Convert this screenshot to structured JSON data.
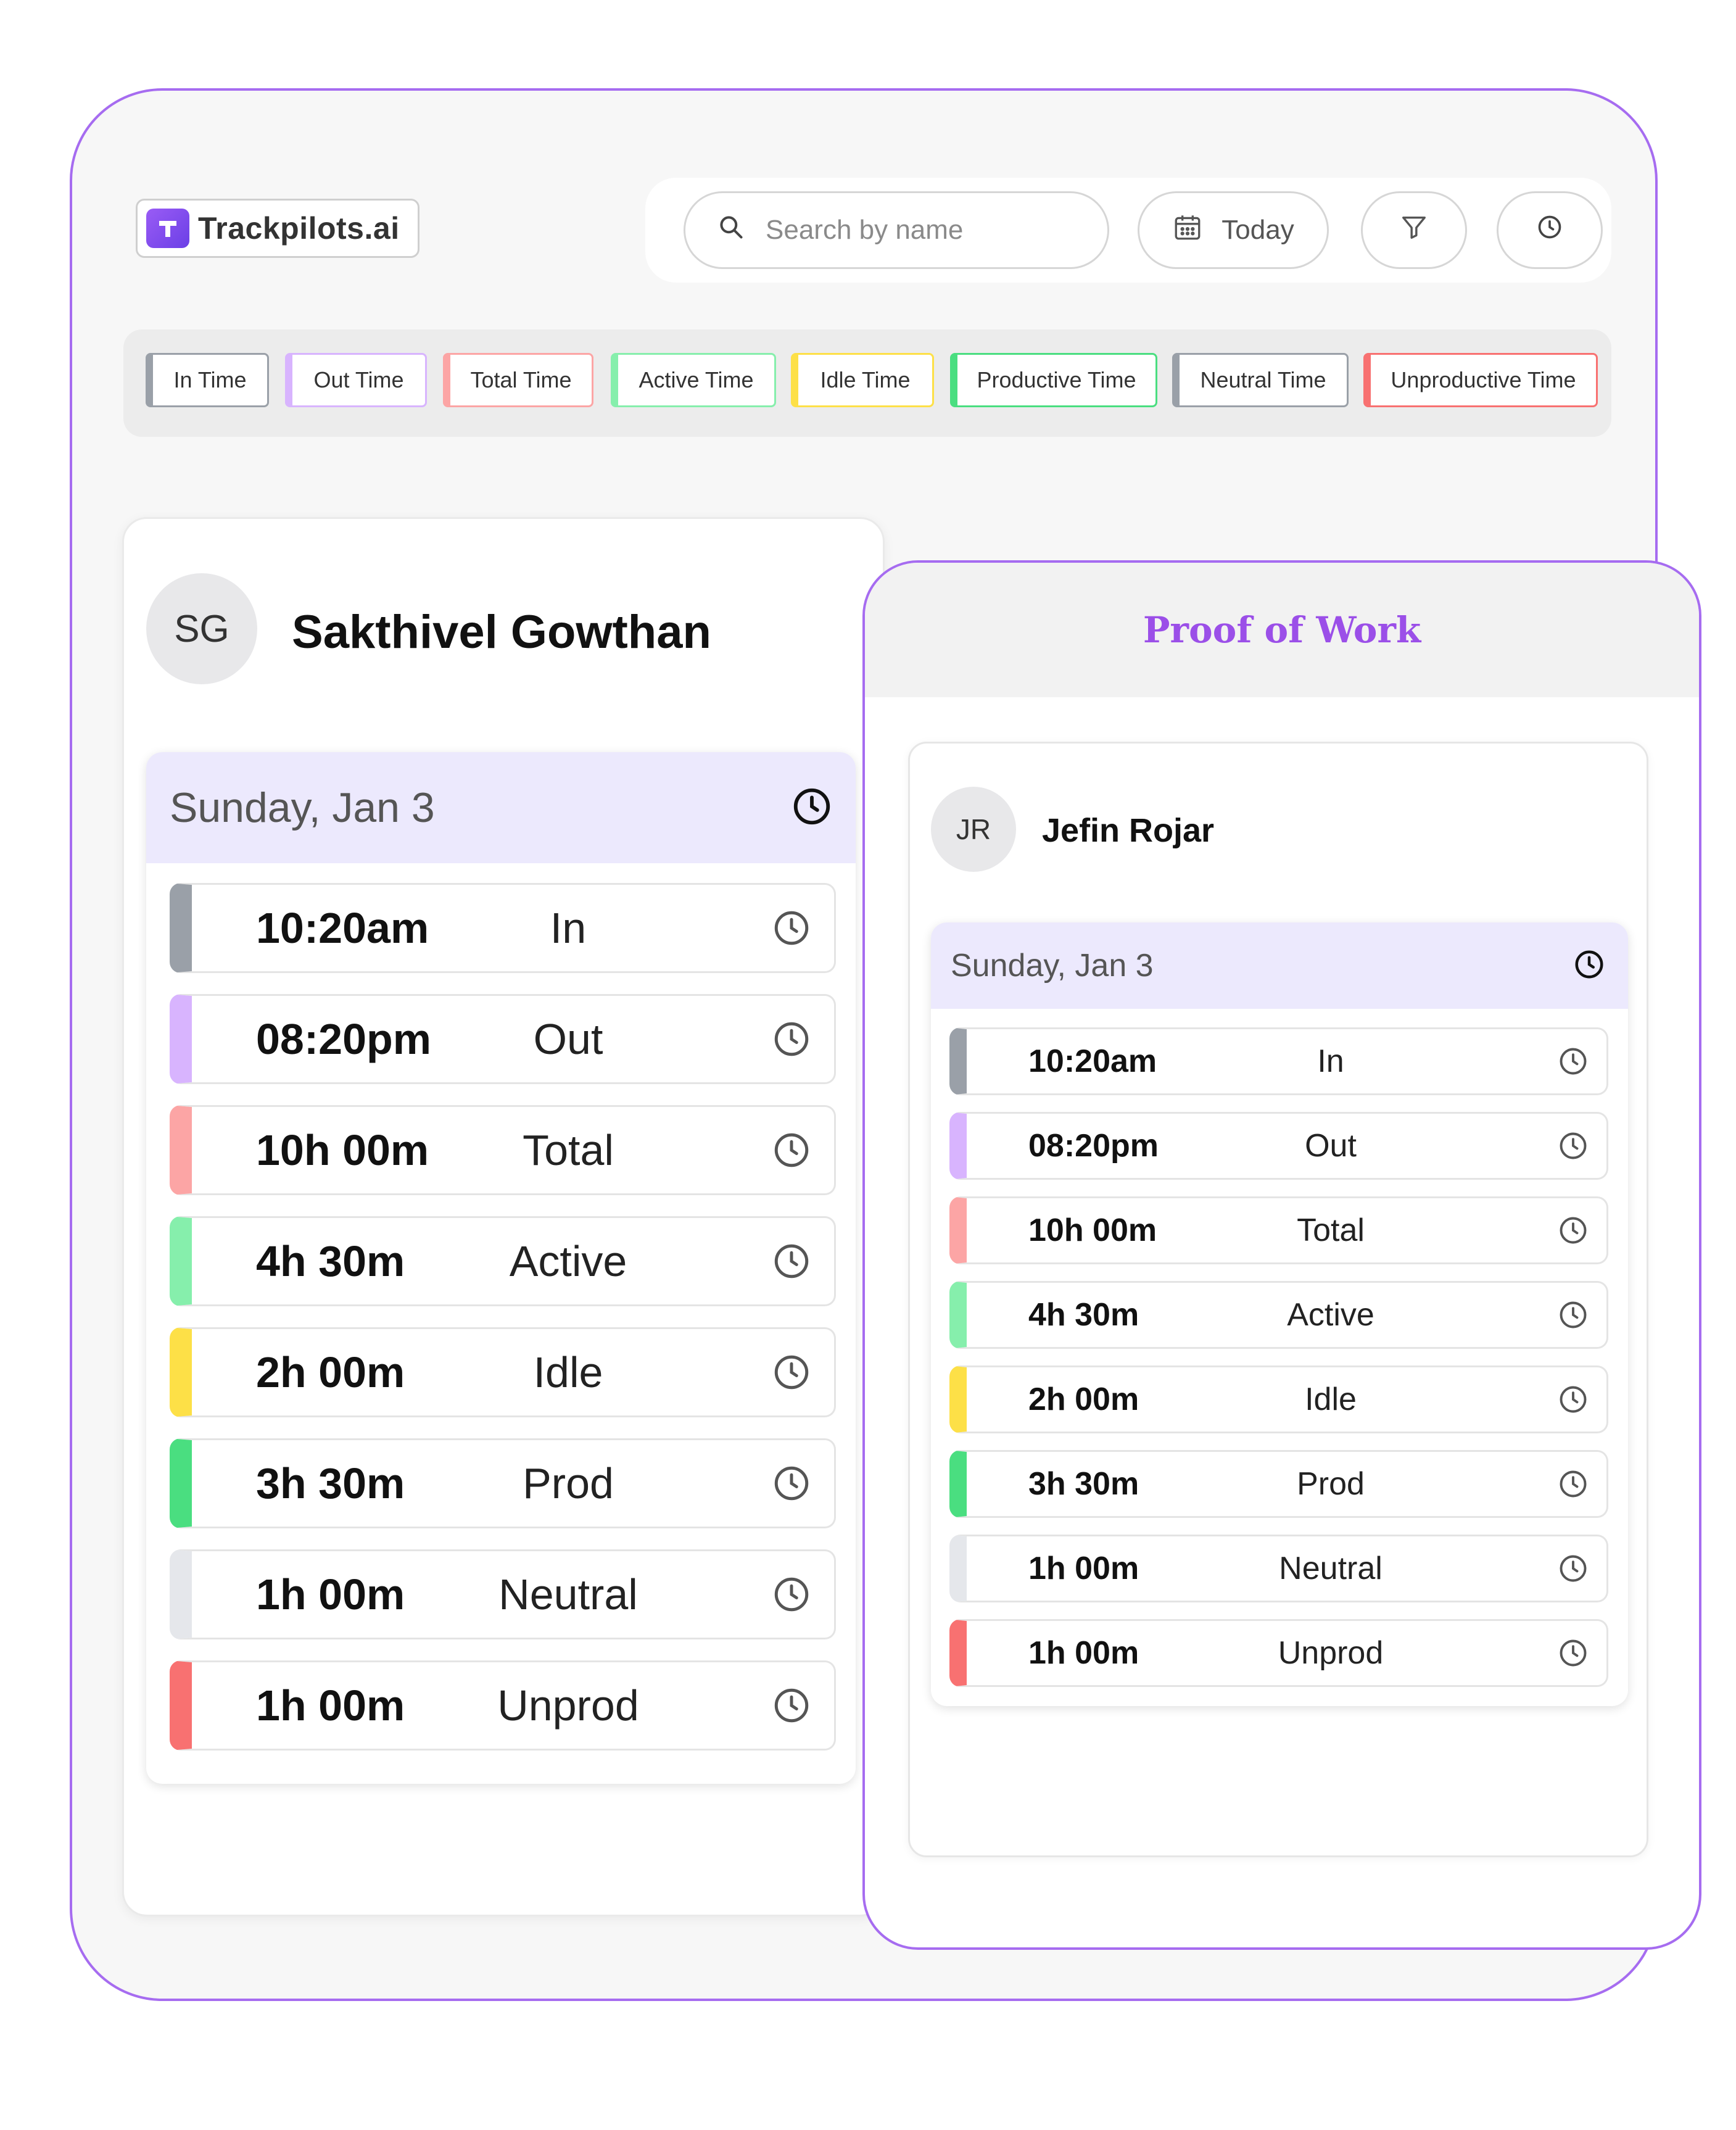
{
  "brand": {
    "name": "Trackpilots.ai",
    "logo_icon": "trackpilots-logo-icon",
    "accent": "#a66cf0"
  },
  "toolbar": {
    "search_placeholder": "Search by name",
    "search_icon": "search-icon",
    "date_label": "Today",
    "date_icon": "calendar-icon",
    "filter_icon": "filter-icon",
    "history_icon": "clock-icon"
  },
  "legend": [
    {
      "label": "In Time",
      "color": "#9aa0a8"
    },
    {
      "label": "Out Time",
      "color": "#d8b4fe"
    },
    {
      "label": "Total Time",
      "color": "#fca5a5"
    },
    {
      "label": "Active Time",
      "color": "#86efac"
    },
    {
      "label": "Idle Time",
      "color": "#fde047"
    },
    {
      "label": "Productive Time",
      "color": "#4ade80"
    },
    {
      "label": "Neutral Time",
      "color": "#9aa0a8"
    },
    {
      "label": "Unproductive Time",
      "color": "#f87171"
    }
  ],
  "left_card": {
    "initials": "SG",
    "name": "Sakthivel Gowthan",
    "day": "Sunday, Jan 3",
    "rows": [
      {
        "value": "10:20am",
        "label": "In",
        "color": "#9aa0a8"
      },
      {
        "value": "08:20pm",
        "label": "Out",
        "color": "#d8b4fe"
      },
      {
        "value": "10h 00m",
        "label": "Total",
        "color": "#fca5a5"
      },
      {
        "value": "4h 30m",
        "label": "Active",
        "color": "#86efac"
      },
      {
        "value": "2h 00m",
        "label": "Idle",
        "color": "#fde047"
      },
      {
        "value": "3h 30m",
        "label": "Prod",
        "color": "#4ade80"
      },
      {
        "value": "1h 00m",
        "label": "Neutral",
        "color": "#e5e7eb"
      },
      {
        "value": "1h 00m",
        "label": "Unprod",
        "color": "#f87171"
      }
    ]
  },
  "right_card": {
    "title": "Proof of Work",
    "initials": "JR",
    "name": "Jefin Rojar",
    "day": "Sunday, Jan 3",
    "rows": [
      {
        "value": "10:20am",
        "label": "In",
        "color": "#9aa0a8"
      },
      {
        "value": "08:20pm",
        "label": "Out",
        "color": "#d8b4fe"
      },
      {
        "value": "10h 00m",
        "label": "Total",
        "color": "#fca5a5"
      },
      {
        "value": "4h 30m",
        "label": "Active",
        "color": "#86efac"
      },
      {
        "value": "2h 00m",
        "label": "Idle",
        "color": "#fde047"
      },
      {
        "value": "3h 30m",
        "label": "Prod",
        "color": "#4ade80"
      },
      {
        "value": "1h 00m",
        "label": "Neutral",
        "color": "#e5e7eb"
      },
      {
        "value": "1h 00m",
        "label": "Unprod",
        "color": "#f87171"
      }
    ]
  }
}
